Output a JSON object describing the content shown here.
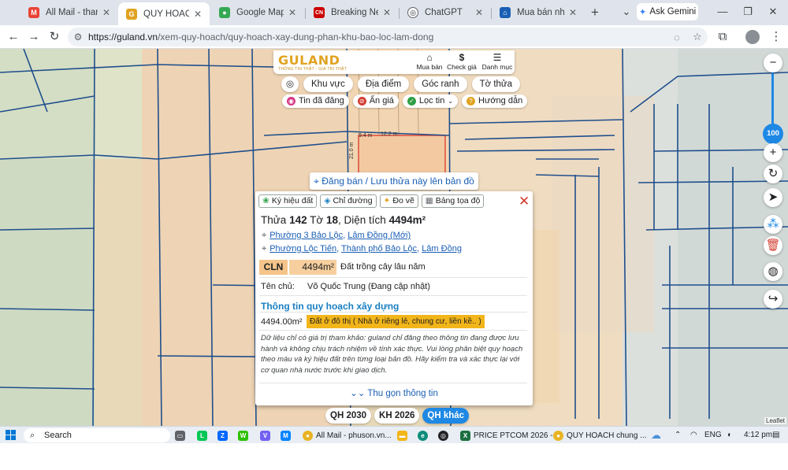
{
  "browser": {
    "tabs": [
      {
        "label": "All Mail - thank.p",
        "icon": "gmail-icon",
        "color": "#ea4335",
        "glyph": "M"
      },
      {
        "label": "QUY HOACH chu",
        "icon": "guland-icon",
        "color": "#e0a321",
        "glyph": "G"
      },
      {
        "label": "Google Maps",
        "icon": "maps-icon",
        "color": "#34a853",
        "glyph": "●"
      },
      {
        "label": "Breaking News, U",
        "icon": "cnn-icon",
        "color": "#cc0000",
        "glyph": "CN"
      },
      {
        "label": "ChatGPT",
        "icon": "chatgpt-icon",
        "color": "#202124",
        "glyph": "◎"
      },
      {
        "label": "Mua bán nhà đất",
        "icon": "house-icon",
        "color": "#1a5fb4",
        "glyph": "⌂"
      }
    ],
    "new_tab": "+",
    "gemini": "Ask Gemini",
    "window_controls": [
      "⌄",
      "—",
      "❐",
      "✕"
    ],
    "url_host": "https://guland.vn",
    "url_path": "/xem-quy-hoach/quy-hoach-xay-dung-phan-khu-bao-loc-lam-dong"
  },
  "header": {
    "logo": "GULAND",
    "tagline": "THÔNG TIN THẬT - GIÁ TRỊ THẬT",
    "nav": [
      {
        "label": "Mua bán",
        "icon": "house-icon",
        "glyph": "⌂"
      },
      {
        "label": "Check giá",
        "icon": "dollar-icon",
        "glyph": "$"
      },
      {
        "label": "Danh mục",
        "icon": "menu-icon",
        "glyph": "☰"
      }
    ]
  },
  "map_controls": {
    "locate_icon": "◎",
    "pills": [
      "Khu vực",
      "Địa điểm",
      "Góc ranh",
      "Tờ thửa"
    ],
    "chips": [
      {
        "label": "Tin đã đăng",
        "icon": "pin-icon",
        "color": "#d63384",
        "glyph": "◉"
      },
      {
        "label": "Ẩn giá",
        "icon": "hide-icon",
        "color": "#d23b2f",
        "glyph": "⊘"
      },
      {
        "label": "Lọc tin",
        "icon": "filter-icon",
        "color": "#2e9e44",
        "glyph": "✓"
      },
      {
        "label": "Hướng dẫn",
        "icon": "guide-icon",
        "color": "#e0a321",
        "glyph": "?"
      }
    ]
  },
  "map_labels": {
    "edge_top": "12.2 m",
    "edge_left": "9.4 m",
    "edge_side": "21.0 m"
  },
  "post_button": "Đăng bán / Lưu thửa này lên bản đồ",
  "popup": {
    "tools": [
      {
        "label": "Ký hiệu đất",
        "icon": "leaf-icon",
        "color": "#2e9e44",
        "glyph": "❀"
      },
      {
        "label": "Chỉ đường",
        "icon": "direction-icon",
        "color": "#1a7fc2",
        "glyph": "◈"
      },
      {
        "label": "Đo vẽ",
        "icon": "measure-icon",
        "color": "#e0a321",
        "glyph": "✦"
      },
      {
        "label": "Bảng tọa độ",
        "icon": "table-icon",
        "color": "#5f6368",
        "glyph": "▦"
      }
    ],
    "close": "✕",
    "title": {
      "prefix": "Thửa",
      "parcel": "142",
      "sheet_label": "Tờ",
      "sheet": "18",
      "area_label": ", Diện tích",
      "area": "4494m²"
    },
    "address_new": {
      "ward": "Phường 3 Bảo Lộc",
      "province": "Lâm Đồng (Mới)"
    },
    "address_old": {
      "ward": "Phường Lộc Tiến",
      "city": "Thành phố Bảo Lộc",
      "province": "Lâm Đồng"
    },
    "land_code": "CLN",
    "land_area": "4494m²",
    "land_desc": "Đất trồng cây lâu năm",
    "owner_label": "Tên chủ:",
    "owner_value": "Võ Quốc Trung (Đang cập nhật)",
    "planning_heading": "Thông tin quy hoạch xây dựng",
    "planning_area": "4494.00m²",
    "planning_type": "Đất ở đô thị ( Nhà ở riêng lẻ, chung cư, liền kề.. )",
    "disclaimer": "Dữ liệu chỉ có giá trị tham khảo: guland chỉ đăng theo thông tin đang được lưu hành và không chịu trách nhiệm về tính xác thực. Vui lòng phân biệt quy hoạch theo màu và ký hiệu đất trên từng loại bản đồ. Hãy kiểm tra và xác thực lại với cơ quan nhà nước trước khi giao dịch.",
    "collapse": "Thu gọn thông tin"
  },
  "plan_tabs": [
    {
      "label": "QH 2030",
      "active": false
    },
    {
      "label": "KH 2026",
      "active": false
    },
    {
      "label": "QH khác",
      "active": true
    }
  ],
  "zoom_level": "100",
  "attribution": "Leaflet",
  "taskbar": {
    "search": "Search",
    "apps": [
      {
        "label": "All Mail - phuson.vn...",
        "icon": "chrome-icon",
        "color": "#e8b423"
      },
      {
        "label": "PRICE PTCOM 2026 - ...",
        "icon": "excel-icon",
        "color": "#1d6f42"
      },
      {
        "label": "QUY HOACH chung ...",
        "icon": "chrome-icon",
        "color": "#e8b423"
      }
    ],
    "language": "ENG",
    "time": "4:12 pm"
  },
  "colors": {
    "accent": "#1e88e5",
    "brand": "#e0a321",
    "link": "#1a5fb4"
  }
}
